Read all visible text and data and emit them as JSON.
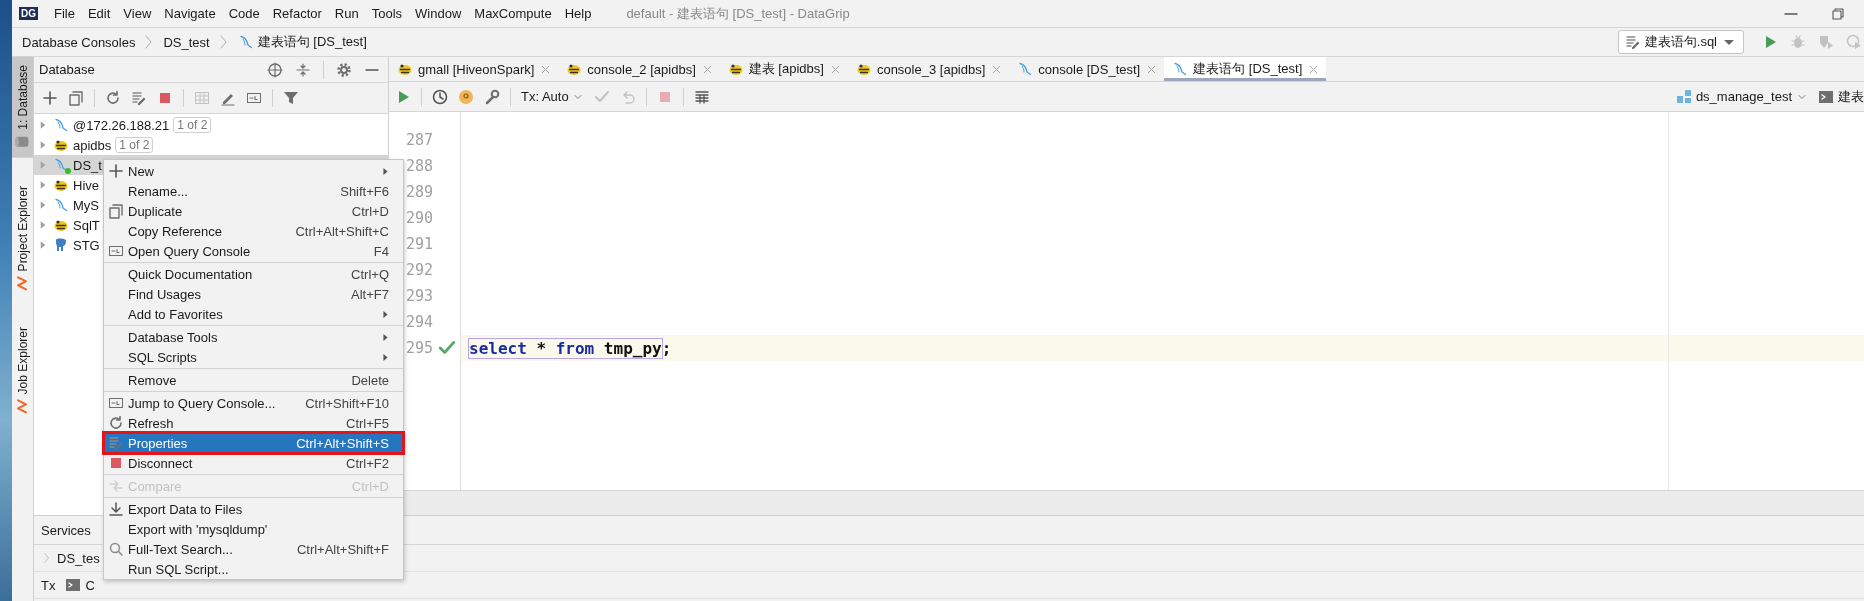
{
  "window": {
    "logo": "DG",
    "title": "default - 建表语句 [DS_test] - DataGrip"
  },
  "menu_bar": [
    "File",
    "Edit",
    "View",
    "Navigate",
    "Code",
    "Refactor",
    "Run",
    "Tools",
    "Window",
    "MaxCompute",
    "Help"
  ],
  "breadcrumbs": [
    "Database Consoles",
    "DS_test",
    "建表语句 [DS_test]"
  ],
  "run_toolbar": {
    "config": "建表语句.sql",
    "buttons": [
      {
        "disabled": false
      },
      {
        "disabled": true
      },
      {
        "disabled": true
      },
      {
        "disabled": true
      }
    ]
  },
  "tool_stripe": [
    {
      "label": "1: Database",
      "selected": true
    },
    {
      "label": "Project Explorer",
      "selected": false
    },
    {
      "label": "Job Explorer",
      "selected": false
    }
  ],
  "database_panel": {
    "title": "Database",
    "toolbar": [
      {
        "kind": "button",
        "disabled": false
      },
      {
        "kind": "button",
        "disabled": false
      },
      {
        "kind": "separator"
      },
      {
        "kind": "button",
        "disabled": false
      },
      {
        "kind": "button",
        "disabled": false
      },
      {
        "kind": "button",
        "disabled": false
      },
      {
        "kind": "separator"
      },
      {
        "kind": "button",
        "disabled": true
      },
      {
        "kind": "button",
        "disabled": false
      },
      {
        "kind": "button",
        "disabled": false
      },
      {
        "kind": "separator"
      },
      {
        "kind": "button",
        "disabled": false
      }
    ],
    "tree": [
      {
        "label": "@172.26.188.21",
        "badge": "1 of 2",
        "kind": "mysql",
        "connected": false,
        "selected": false
      },
      {
        "label": "apidbs",
        "badge": "1 of 2",
        "kind": "hive",
        "connected": false,
        "selected": false
      },
      {
        "label": "DS_t",
        "kind": "mysql",
        "connected": true,
        "selected": true
      },
      {
        "label": "Hive",
        "kind": "hive",
        "connected": false,
        "selected": false
      },
      {
        "label": "MyS",
        "kind": "mysql",
        "connected": false,
        "selected": false
      },
      {
        "label": "SqlT",
        "kind": "hive",
        "connected": false,
        "selected": false
      },
      {
        "label": "STG",
        "kind": "postgres",
        "connected": false,
        "selected": false
      }
    ]
  },
  "editor_tabs": [
    {
      "label": "gmall [HiveonSpark]",
      "kind": "hive",
      "selected": false
    },
    {
      "label": "console_2 [apidbs]",
      "kind": "hive",
      "selected": false
    },
    {
      "label": "建表 [apidbs]",
      "kind": "hive",
      "selected": false
    },
    {
      "label": "console_3 [apidbs]",
      "kind": "hive",
      "selected": false
    },
    {
      "label": "console [DS_test]",
      "kind": "mysql",
      "selected": false
    },
    {
      "label": "建表语句 [DS_test]",
      "kind": "mysql",
      "selected": true
    }
  ],
  "editor_toolbar": {
    "buttons": [
      {
        "kind": "button",
        "disabled": false
      },
      {
        "kind": "separator"
      },
      {
        "kind": "button",
        "disabled": false
      },
      {
        "kind": "button",
        "disabled": false
      },
      {
        "kind": "button",
        "disabled": false
      },
      {
        "kind": "separator"
      },
      {
        "kind": "tx",
        "label": "Tx: Auto"
      },
      {
        "kind": "button",
        "disabled": true
      },
      {
        "kind": "button",
        "disabled": true
      },
      {
        "kind": "separator"
      },
      {
        "kind": "button",
        "disabled": true
      },
      {
        "kind": "separator"
      },
      {
        "kind": "button",
        "disabled": false
      }
    ],
    "schema": "ds_manage_test",
    "console": "建表"
  },
  "editor": {
    "lines": [
      {
        "number": "287",
        "current": false,
        "checked": false
      },
      {
        "number": "288",
        "current": false,
        "checked": false
      },
      {
        "number": "289",
        "current": false,
        "checked": false
      },
      {
        "number": "290",
        "current": false,
        "checked": false
      },
      {
        "number": "291",
        "current": false,
        "checked": false
      },
      {
        "number": "292",
        "current": false,
        "checked": false
      },
      {
        "number": "293",
        "current": false,
        "checked": false
      },
      {
        "number": "294",
        "current": false,
        "checked": false
      },
      {
        "number": "295",
        "current": true,
        "checked": true,
        "tokens": [
          {
            "text": "select",
            "kind": "keyword",
            "selected": true
          },
          {
            "text": " * ",
            "kind": "plain",
            "selected": true
          },
          {
            "text": "from",
            "kind": "keyword",
            "selected": true
          },
          {
            "text": " tmp_py",
            "kind": "identifier",
            "selected": true
          },
          {
            "text": ";",
            "kind": "plain",
            "selected": false
          }
        ]
      }
    ]
  },
  "services": {
    "title": "Services",
    "node": "DS_tes",
    "tabs": [
      "Tx",
      "C"
    ]
  },
  "context_menu": [
    {
      "kind": "item",
      "label": "New",
      "submenu": true,
      "disabled": false,
      "selected": false,
      "outlined": false
    },
    {
      "kind": "item",
      "label": "Rename...",
      "shortcut": "Shift+F6",
      "submenu": false,
      "disabled": false,
      "selected": false,
      "outlined": false
    },
    {
      "kind": "item",
      "label": "Duplicate",
      "shortcut": "Ctrl+D",
      "submenu": false,
      "disabled": false,
      "selected": false,
      "outlined": false
    },
    {
      "kind": "item",
      "label": "Copy Reference",
      "shortcut": "Ctrl+Alt+Shift+C",
      "submenu": false,
      "disabled": false,
      "selected": false,
      "outlined": false
    },
    {
      "kind": "item",
      "label": "Open Query Console",
      "shortcut": "F4",
      "submenu": false,
      "disabled": false,
      "selected": false,
      "outlined": false
    },
    {
      "kind": "separator"
    },
    {
      "kind": "item",
      "label": "Quick Documentation",
      "shortcut": "Ctrl+Q",
      "submenu": false,
      "disabled": false,
      "selected": false,
      "outlined": false
    },
    {
      "kind": "item",
      "label": "Find Usages",
      "shortcut": "Alt+F7",
      "submenu": false,
      "disabled": false,
      "selected": false,
      "outlined": false
    },
    {
      "kind": "item",
      "label": "Add to Favorites",
      "submenu": true,
      "disabled": false,
      "selected": false,
      "outlined": false
    },
    {
      "kind": "separator"
    },
    {
      "kind": "item",
      "label": "Database Tools",
      "submenu": true,
      "disabled": false,
      "selected": false,
      "outlined": false
    },
    {
      "kind": "item",
      "label": "SQL Scripts",
      "submenu": true,
      "disabled": false,
      "selected": false,
      "outlined": false
    },
    {
      "kind": "separator"
    },
    {
      "kind": "item",
      "label": "Remove",
      "shortcut": "Delete",
      "submenu": false,
      "disabled": false,
      "selected": false,
      "outlined": false
    },
    {
      "kind": "separator"
    },
    {
      "kind": "item",
      "label": "Jump to Query Console...",
      "shortcut": "Ctrl+Shift+F10",
      "submenu": false,
      "disabled": false,
      "selected": false,
      "outlined": false
    },
    {
      "kind": "item",
      "label": "Refresh",
      "shortcut": "Ctrl+F5",
      "submenu": false,
      "disabled": false,
      "selected": false,
      "outlined": false
    },
    {
      "kind": "item",
      "label": "Properties",
      "shortcut": "Ctrl+Alt+Shift+S",
      "submenu": false,
      "disabled": false,
      "selected": true,
      "outlined": true
    },
    {
      "kind": "item",
      "label": "Disconnect",
      "shortcut": "Ctrl+F2",
      "submenu": false,
      "disabled": false,
      "selected": false,
      "outlined": false
    },
    {
      "kind": "separator"
    },
    {
      "kind": "item",
      "label": "Compare",
      "shortcut": "Ctrl+D",
      "submenu": false,
      "disabled": true,
      "selected": false,
      "outlined": false
    },
    {
      "kind": "separator"
    },
    {
      "kind": "item",
      "label": "Export Data to Files",
      "submenu": false,
      "disabled": false,
      "selected": false,
      "outlined": false
    },
    {
      "kind": "item",
      "label": "Export with 'mysqldump'",
      "submenu": false,
      "disabled": false,
      "selected": false,
      "outlined": false
    },
    {
      "kind": "item",
      "label": "Full-Text Search...",
      "shortcut": "Ctrl+Alt+Shift+F",
      "submenu": false,
      "disabled": false,
      "selected": false,
      "outlined": false
    },
    {
      "kind": "item",
      "label": "Run SQL Script...",
      "submenu": false,
      "disabled": false,
      "selected": false,
      "outlined": false
    }
  ]
}
